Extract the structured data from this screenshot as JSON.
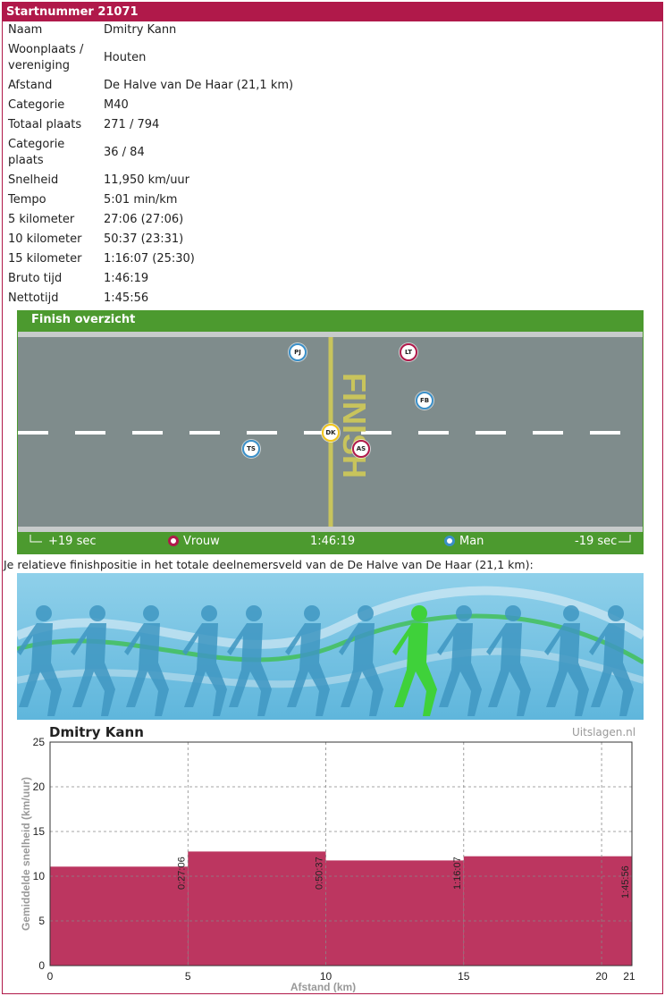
{
  "header": {
    "title": "Startnummer 21071"
  },
  "info": [
    {
      "label": "Naam",
      "value": "Dmitry Kann"
    },
    {
      "label": "Woonplaats / vereniging",
      "value": "Houten"
    },
    {
      "label": "Afstand",
      "value": "De Halve van De Haar (21,1 km)"
    },
    {
      "label": "Categorie",
      "value": "M40"
    },
    {
      "label": "Totaal plaats",
      "value": "271 / 794"
    },
    {
      "label": "Categorie plaats",
      "value": "36 / 84"
    },
    {
      "label": "Snelheid",
      "value": "11,950 km/uur"
    },
    {
      "label": "Tempo",
      "value": "5:01 min/km"
    },
    {
      "label": "5 kilometer",
      "value": "27:06 (27:06)"
    },
    {
      "label": "10 kilometer",
      "value": "50:37 (23:31)"
    },
    {
      "label": "15 kilometer",
      "value": "1:16:07 (25:30)"
    },
    {
      "label": "Bruto tijd",
      "value": "1:46:19"
    },
    {
      "label": "Nettotijd",
      "value": "1:45:56"
    }
  ],
  "finish": {
    "title": "Finish overzicht",
    "finish_text": "FINISH",
    "left_label": "+19 sec",
    "right_label": "-19 sec",
    "center_time": "1:46:19",
    "legend_female": "Vrouw",
    "legend_male": "Man",
    "color_female": "#b0194a",
    "color_male": "#3a8fc8",
    "color_self": "#f2c51a",
    "runners": [
      {
        "initials": "PJ",
        "gender": "male",
        "lane": "top"
      },
      {
        "initials": "LT",
        "gender": "female",
        "lane": "top"
      },
      {
        "initials": "FB",
        "gender": "male",
        "lane": "upper"
      },
      {
        "initials": "DK",
        "gender": "self",
        "lane": "middle"
      },
      {
        "initials": "TS",
        "gender": "male",
        "lane": "lower"
      },
      {
        "initials": "AS",
        "gender": "female",
        "lane": "lower"
      }
    ]
  },
  "relative": {
    "label": "Je relatieve finishpositie in het totale deelnemersveld van de De Halve van De Haar (21,1 km):"
  },
  "chart": {
    "title": "Dmitry Kann",
    "credit": "Uitslagen.nl",
    "bar_color": "#bc3660",
    "chart_data": {
      "type": "bar",
      "xlabel": "Afstand (km)",
      "ylabel": "Gemiddelde snelheid (km/uur)",
      "xlim": [
        0,
        21
      ],
      "ylim": [
        0,
        25
      ],
      "xticks": [
        "0",
        "5",
        "10",
        "15",
        "20",
        "21"
      ],
      "yticks": [
        "0",
        "5",
        "10",
        "15",
        "20",
        "25"
      ],
      "segments": [
        {
          "x0": 0,
          "x1": 5,
          "value": 11.07,
          "label": "0:27:06"
        },
        {
          "x0": 5,
          "x1": 10,
          "value": 12.76,
          "label": "0:50:37"
        },
        {
          "x0": 10,
          "x1": 15,
          "value": 11.76,
          "label": "1:16:07"
        },
        {
          "x0": 15,
          "x1": 21.1,
          "value": 12.23,
          "label": "1:45:56"
        }
      ]
    }
  }
}
